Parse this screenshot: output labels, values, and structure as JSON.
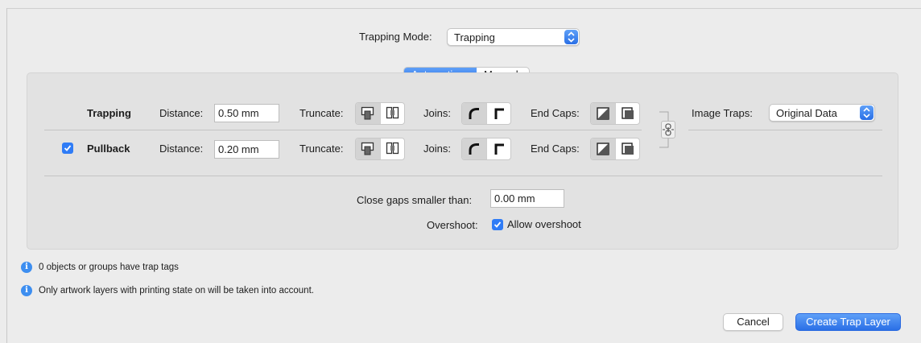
{
  "trapping_mode": {
    "label": "Trapping Mode:",
    "value": "Trapping"
  },
  "tabs": [
    {
      "label": "Automatic",
      "selected": true
    },
    {
      "label": "Manual",
      "selected": false
    }
  ],
  "trapping_row": {
    "title": "Trapping",
    "distance_label": "Distance:",
    "distance_value": "0.50 mm",
    "truncate_label": "Truncate:",
    "joins_label": "Joins:",
    "endcaps_label": "End Caps:"
  },
  "pullback_row": {
    "checked": true,
    "title": "Pullback",
    "distance_label": "Distance:",
    "distance_value": "0.20 mm",
    "truncate_label": "Truncate:",
    "joins_label": "Joins:",
    "endcaps_label": "End Caps:"
  },
  "image_traps": {
    "label": "Image Traps:",
    "value": "Original Data"
  },
  "close_gaps": {
    "label": "Close gaps smaller than:",
    "value": "0.00 mm"
  },
  "overshoot": {
    "label": "Overshoot:",
    "checkbox_label": "Allow overshoot",
    "checked": true
  },
  "info": [
    "0 objects or groups have trap tags",
    "Only artwork layers with printing state on will be taken into account."
  ],
  "buttons": {
    "cancel": "Cancel",
    "create": "Create Trap Layer"
  },
  "colors": {
    "accent": "#2f7cf6",
    "panel": "#e2e2e2",
    "background": "#ececec"
  },
  "icons": {
    "truncate": [
      "truncate-inside-icon",
      "truncate-outside-icon"
    ],
    "joins": [
      "round-join-icon",
      "miter-join-icon"
    ],
    "endcaps": [
      "endcap-diagonal-icon",
      "endcap-square-icon"
    ],
    "link": "chain-link-icon",
    "info": "info-icon"
  }
}
